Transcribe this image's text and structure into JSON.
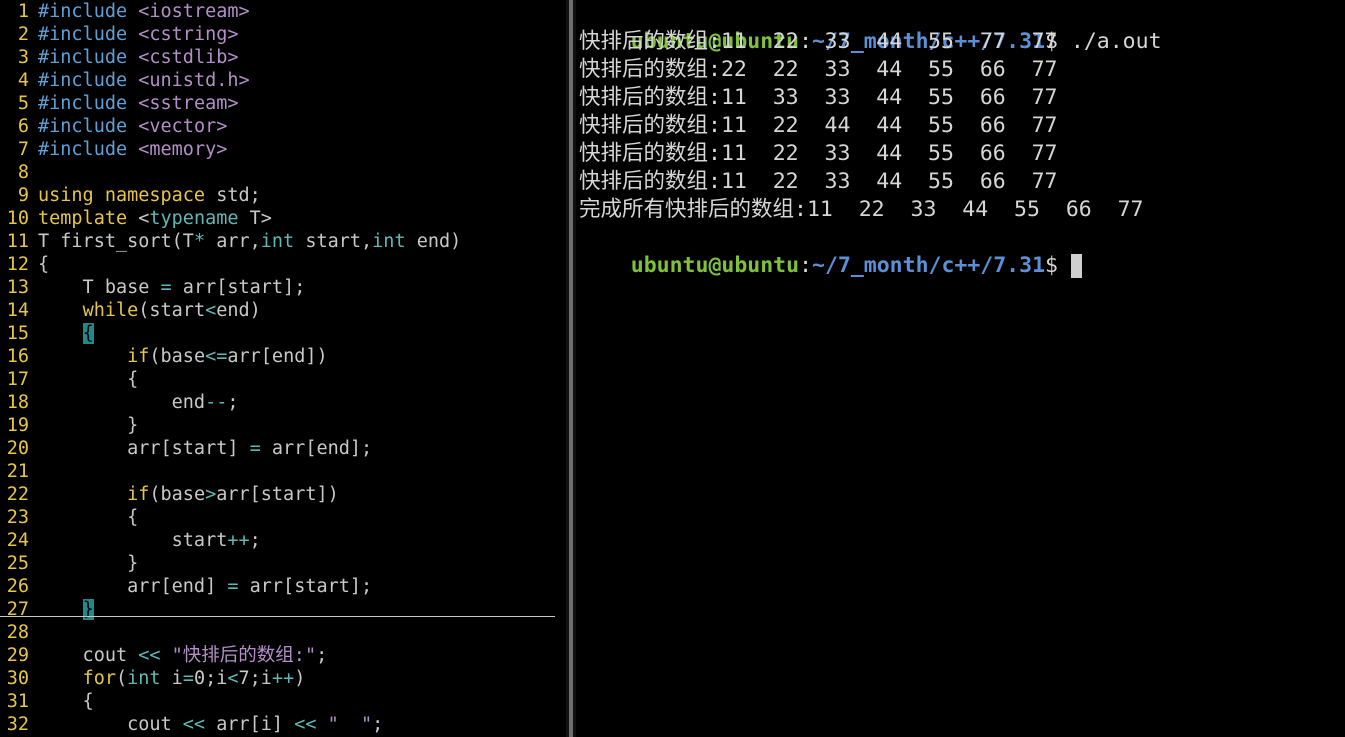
{
  "editor": {
    "lines": [
      {
        "n": "1",
        "segs": [
          {
            "t": "#include ",
            "c": "pre"
          },
          {
            "t": "<iostream>",
            "c": "inc"
          }
        ]
      },
      {
        "n": "2",
        "segs": [
          {
            "t": "#include ",
            "c": "pre"
          },
          {
            "t": "<cstring>",
            "c": "inc"
          }
        ]
      },
      {
        "n": "3",
        "segs": [
          {
            "t": "#include ",
            "c": "pre"
          },
          {
            "t": "<cstdlib>",
            "c": "inc"
          }
        ]
      },
      {
        "n": "4",
        "segs": [
          {
            "t": "#include ",
            "c": "pre"
          },
          {
            "t": "<unistd.h>",
            "c": "inc"
          }
        ]
      },
      {
        "n": "5",
        "segs": [
          {
            "t": "#include ",
            "c": "pre"
          },
          {
            "t": "<sstream>",
            "c": "inc"
          }
        ]
      },
      {
        "n": "6",
        "segs": [
          {
            "t": "#include ",
            "c": "pre"
          },
          {
            "t": "<vector>",
            "c": "inc"
          }
        ]
      },
      {
        "n": "7",
        "segs": [
          {
            "t": "#include ",
            "c": "pre"
          },
          {
            "t": "<memory>",
            "c": "inc"
          }
        ]
      },
      {
        "n": "8",
        "segs": []
      },
      {
        "n": "9",
        "segs": [
          {
            "t": "using namespace",
            "c": "kw"
          },
          {
            "t": " std;",
            "c": ""
          }
        ]
      },
      {
        "n": "10",
        "segs": [
          {
            "t": "template",
            "c": "kw"
          },
          {
            "t": " <",
            "c": ""
          },
          {
            "t": "typename",
            "c": "ty"
          },
          {
            "t": " T>",
            "c": ""
          }
        ]
      },
      {
        "n": "11",
        "segs": [
          {
            "t": "T first_sort(T",
            "c": ""
          },
          {
            "t": "*",
            "c": "op"
          },
          {
            "t": " arr,",
            "c": ""
          },
          {
            "t": "int",
            "c": "ty"
          },
          {
            "t": " start,",
            "c": ""
          },
          {
            "t": "int",
            "c": "ty"
          },
          {
            "t": " end)",
            "c": ""
          }
        ]
      },
      {
        "n": "12",
        "segs": [
          {
            "t": "{",
            "c": ""
          }
        ]
      },
      {
        "n": "13",
        "segs": [
          {
            "t": "    T base ",
            "c": ""
          },
          {
            "t": "=",
            "c": "op"
          },
          {
            "t": " arr[start];",
            "c": ""
          }
        ]
      },
      {
        "n": "14",
        "segs": [
          {
            "t": "    ",
            "c": ""
          },
          {
            "t": "while",
            "c": "kw"
          },
          {
            "t": "(start",
            "c": ""
          },
          {
            "t": "<",
            "c": "op"
          },
          {
            "t": "end)",
            "c": ""
          }
        ]
      },
      {
        "n": "15",
        "segs": [
          {
            "t": "    ",
            "c": ""
          },
          {
            "t": "{",
            "c": "match"
          }
        ]
      },
      {
        "n": "16",
        "segs": [
          {
            "t": "        ",
            "c": ""
          },
          {
            "t": "if",
            "c": "kw"
          },
          {
            "t": "(base",
            "c": ""
          },
          {
            "t": "<=",
            "c": "op"
          },
          {
            "t": "arr[end])",
            "c": ""
          }
        ]
      },
      {
        "n": "17",
        "segs": [
          {
            "t": "        {",
            "c": ""
          }
        ]
      },
      {
        "n": "18",
        "segs": [
          {
            "t": "            end",
            "c": ""
          },
          {
            "t": "--",
            "c": "op"
          },
          {
            "t": ";",
            "c": ""
          }
        ]
      },
      {
        "n": "19",
        "segs": [
          {
            "t": "        }",
            "c": ""
          }
        ]
      },
      {
        "n": "20",
        "segs": [
          {
            "t": "        arr[start] ",
            "c": ""
          },
          {
            "t": "=",
            "c": "op"
          },
          {
            "t": " arr[end];",
            "c": ""
          }
        ]
      },
      {
        "n": "21",
        "segs": []
      },
      {
        "n": "22",
        "segs": [
          {
            "t": "        ",
            "c": ""
          },
          {
            "t": "if",
            "c": "kw"
          },
          {
            "t": "(base",
            "c": ""
          },
          {
            "t": ">",
            "c": "op"
          },
          {
            "t": "arr[start])",
            "c": ""
          }
        ]
      },
      {
        "n": "23",
        "segs": [
          {
            "t": "        {",
            "c": ""
          }
        ]
      },
      {
        "n": "24",
        "segs": [
          {
            "t": "            start",
            "c": ""
          },
          {
            "t": "++",
            "c": "op"
          },
          {
            "t": ";",
            "c": ""
          }
        ]
      },
      {
        "n": "25",
        "segs": [
          {
            "t": "        }",
            "c": ""
          }
        ]
      },
      {
        "n": "26",
        "segs": [
          {
            "t": "        arr[end] ",
            "c": ""
          },
          {
            "t": "=",
            "c": "op"
          },
          {
            "t": " arr[start];",
            "c": ""
          }
        ]
      },
      {
        "n": "27",
        "segs": [
          {
            "t": "    ",
            "c": ""
          },
          {
            "t": "}",
            "c": "match"
          }
        ]
      },
      {
        "n": "28",
        "segs": []
      },
      {
        "n": "29",
        "segs": [
          {
            "t": "    cout ",
            "c": ""
          },
          {
            "t": "<<",
            "c": "op"
          },
          {
            "t": " ",
            "c": ""
          },
          {
            "t": "\"快排后的数组:\"",
            "c": "str"
          },
          {
            "t": ";",
            "c": ""
          }
        ]
      },
      {
        "n": "30",
        "segs": [
          {
            "t": "    ",
            "c": ""
          },
          {
            "t": "for",
            "c": "kw"
          },
          {
            "t": "(",
            "c": ""
          },
          {
            "t": "int",
            "c": "ty"
          },
          {
            "t": " i",
            "c": ""
          },
          {
            "t": "=",
            "c": "op"
          },
          {
            "t": "0;i",
            "c": ""
          },
          {
            "t": "<",
            "c": "op"
          },
          {
            "t": "7;i",
            "c": ""
          },
          {
            "t": "++",
            "c": "op"
          },
          {
            "t": ")",
            "c": ""
          }
        ]
      },
      {
        "n": "31",
        "segs": [
          {
            "t": "    {",
            "c": ""
          }
        ]
      },
      {
        "n": "32",
        "segs": [
          {
            "t": "        cout ",
            "c": ""
          },
          {
            "t": "<<",
            "c": "op"
          },
          {
            "t": " arr[i] ",
            "c": ""
          },
          {
            "t": "<<",
            "c": "op"
          },
          {
            "t": " ",
            "c": ""
          },
          {
            "t": "\"  \"",
            "c": "str"
          },
          {
            "t": ";",
            "c": ""
          }
        ]
      }
    ]
  },
  "terminal": {
    "user_host": "ubuntu@ubuntu",
    "colon": ":",
    "cwd": "~/7_month/c++/7.31",
    "prompt_symbol": "$ ",
    "command": "./a.out",
    "output": [
      "快排后的数组:11  22  33  44  55  77  77",
      "快排后的数组:22  22  33  44  55  66  77",
      "快排后的数组:11  33  33  44  55  66  77",
      "快排后的数组:11  22  44  44  55  66  77",
      "快排后的数组:11  22  33  44  55  66  77",
      "快排后的数组:11  22  33  44  55  66  77",
      "完成所有快排后的数组:11  22  33  44  55  66  77"
    ]
  }
}
